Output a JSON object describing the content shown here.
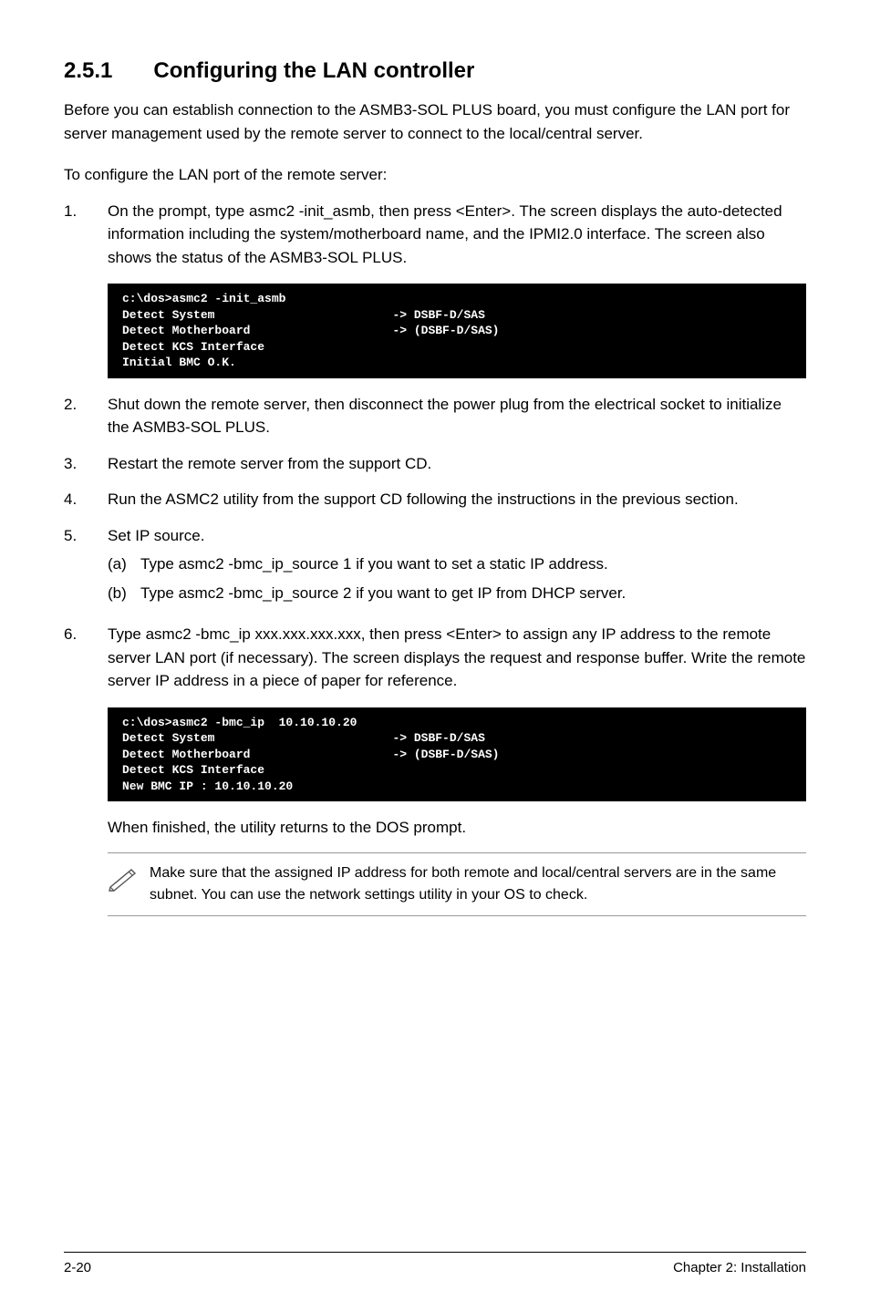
{
  "heading": {
    "number": "2.5.1",
    "title": "Configuring the LAN controller"
  },
  "intro": "Before you can establish connection to the ASMB3-SOL PLUS board, you must configure the LAN port for server management used by the remote server to connect to the local/central server.",
  "subintro": "To configure the LAN port of the remote server:",
  "steps": {
    "s1": {
      "num": "1.",
      "text": "On the prompt, type asmc2 -init_asmb, then press <Enter>. The screen displays the auto-detected information including the system/motherboard name, and the IPMI2.0 interface. The screen also shows the status of the ASMB3-SOL PLUS."
    },
    "s2": {
      "num": "2.",
      "text": "Shut down the remote server, then disconnect the power plug from the electrical socket to initialize the ASMB3-SOL PLUS."
    },
    "s3": {
      "num": "3.",
      "text": "Restart the remote server from the support CD."
    },
    "s4": {
      "num": "4.",
      "text": "Run the ASMC2 utility from the support CD following the instructions in the previous section."
    },
    "s5": {
      "num": "5.",
      "text": "Set IP source.",
      "a": {
        "mark": "(a)",
        "text": "Type asmc2 -bmc_ip_source 1 if you want to set a static IP address."
      },
      "b": {
        "mark": "(b)",
        "text": "Type asmc2 -bmc_ip_source 2 if you want to get IP from DHCP server."
      }
    },
    "s6": {
      "num": "6.",
      "text": "Type asmc2 -bmc_ip xxx.xxx.xxx.xxx, then press <Enter> to assign any IP address to the remote server LAN port (if necessary). The screen displays the request and response buffer. Write the remote server IP address in a piece of paper for reference."
    }
  },
  "console1": "c:\\dos>asmc2 -init_asmb\nDetect System                         -> DSBF-D/SAS\nDetect Motherboard                    -> (DSBF-D/SAS)\nDetect KCS Interface\nInitial BMC O.K.",
  "console2": "c:\\dos>asmc2 -bmc_ip  10.10.10.20\nDetect System                         -> DSBF-D/SAS\nDetect Motherboard                    -> (DSBF-D/SAS)\nDetect KCS Interface\nNew BMC IP : 10.10.10.20",
  "after_console2": "When finished, the utility returns to the DOS prompt.",
  "note": "Make sure that the assigned IP address for both remote and local/central servers are in the same subnet. You can use the network settings utility in your OS to check.",
  "footer": {
    "left": "2-20",
    "right": "Chapter 2: Installation"
  }
}
